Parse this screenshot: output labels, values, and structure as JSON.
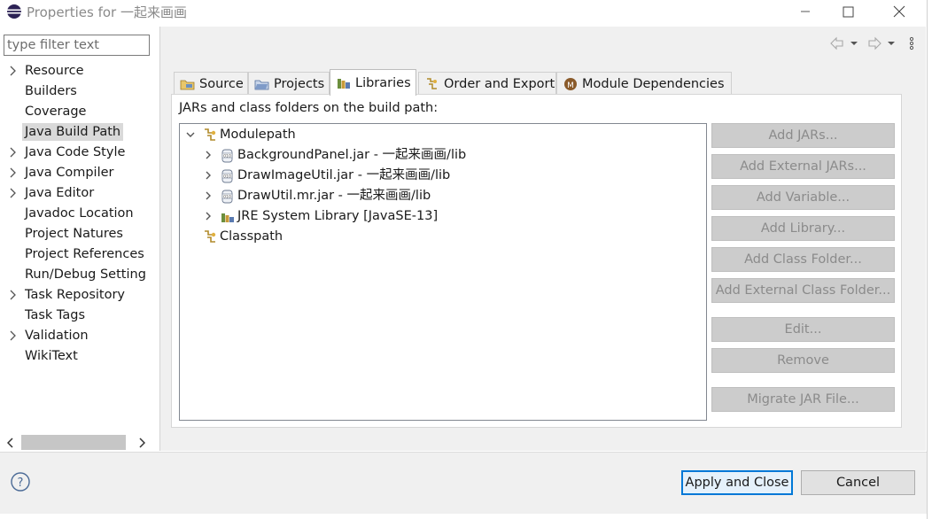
{
  "window": {
    "title": "Properties for 一起来画画",
    "icon": "eclipse-icon",
    "controls": [
      "minimize-icon",
      "maximize-icon",
      "close-icon"
    ]
  },
  "filter": {
    "placeholder": "type filter text",
    "value": ""
  },
  "nav_items": [
    {
      "label": "Resource",
      "expandable": true
    },
    {
      "label": "Builders",
      "expandable": false
    },
    {
      "label": "Coverage",
      "expandable": false
    },
    {
      "label": "Java Build Path",
      "expandable": false,
      "selected": true
    },
    {
      "label": "Java Code Style",
      "expandable": true
    },
    {
      "label": "Java Compiler",
      "expandable": true
    },
    {
      "label": "Java Editor",
      "expandable": true
    },
    {
      "label": "Javadoc Location",
      "expandable": false
    },
    {
      "label": "Project Natures",
      "expandable": false
    },
    {
      "label": "Project References",
      "expandable": false
    },
    {
      "label": "Run/Debug Setting",
      "expandable": false
    },
    {
      "label": "Task Repository",
      "expandable": true
    },
    {
      "label": "Task Tags",
      "expandable": false
    },
    {
      "label": "Validation",
      "expandable": true
    },
    {
      "label": "WikiText",
      "expandable": false
    }
  ],
  "tabs": [
    {
      "label": "Source",
      "icon": "source-folder-icon"
    },
    {
      "label": "Projects",
      "icon": "projects-folder-icon"
    },
    {
      "label": "Libraries",
      "icon": "libraries-icon",
      "active": true
    },
    {
      "label": "Order and Export",
      "icon": "order-export-icon"
    },
    {
      "label": "Module Dependencies",
      "icon": "module-icon"
    }
  ],
  "libraries": {
    "caption": "JARs and class folders on the build path:",
    "tree": [
      {
        "label": "Modulepath",
        "icon": "modulepath-icon",
        "level": 0,
        "expanded": true
      },
      {
        "label": "BackgroundPanel.jar - 一起来画画/lib",
        "icon": "jar-icon",
        "level": 1,
        "expanded": false
      },
      {
        "label": "DrawImageUtil.jar - 一起来画画/lib",
        "icon": "jar-icon",
        "level": 1,
        "expanded": false
      },
      {
        "label": "DrawUtil.mr.jar - 一起来画画/lib",
        "icon": "jar-icon",
        "level": 1,
        "expanded": false
      },
      {
        "label": "JRE System Library [JavaSE-13]",
        "icon": "jre-library-icon",
        "level": 1,
        "expanded": false
      },
      {
        "label": "Classpath",
        "icon": "classpath-icon",
        "level": 0,
        "expanded": null
      }
    ],
    "buttons": [
      "Add JARs...",
      "Add External JARs...",
      "Add Variable...",
      "Add Library...",
      "Add Class Folder...",
      "Add External Class Folder...",
      "Edit...",
      "Remove",
      "Migrate JAR File..."
    ]
  },
  "footer": {
    "apply_close_label": "Apply and Close",
    "cancel_label": "Cancel",
    "help_icon": "help-icon"
  },
  "colors": {
    "accent": "#0078d7",
    "panel_bg": "#f0f0f0",
    "selected_bg": "#d9d9d9",
    "disabled_button_bg": "#cccccc"
  }
}
